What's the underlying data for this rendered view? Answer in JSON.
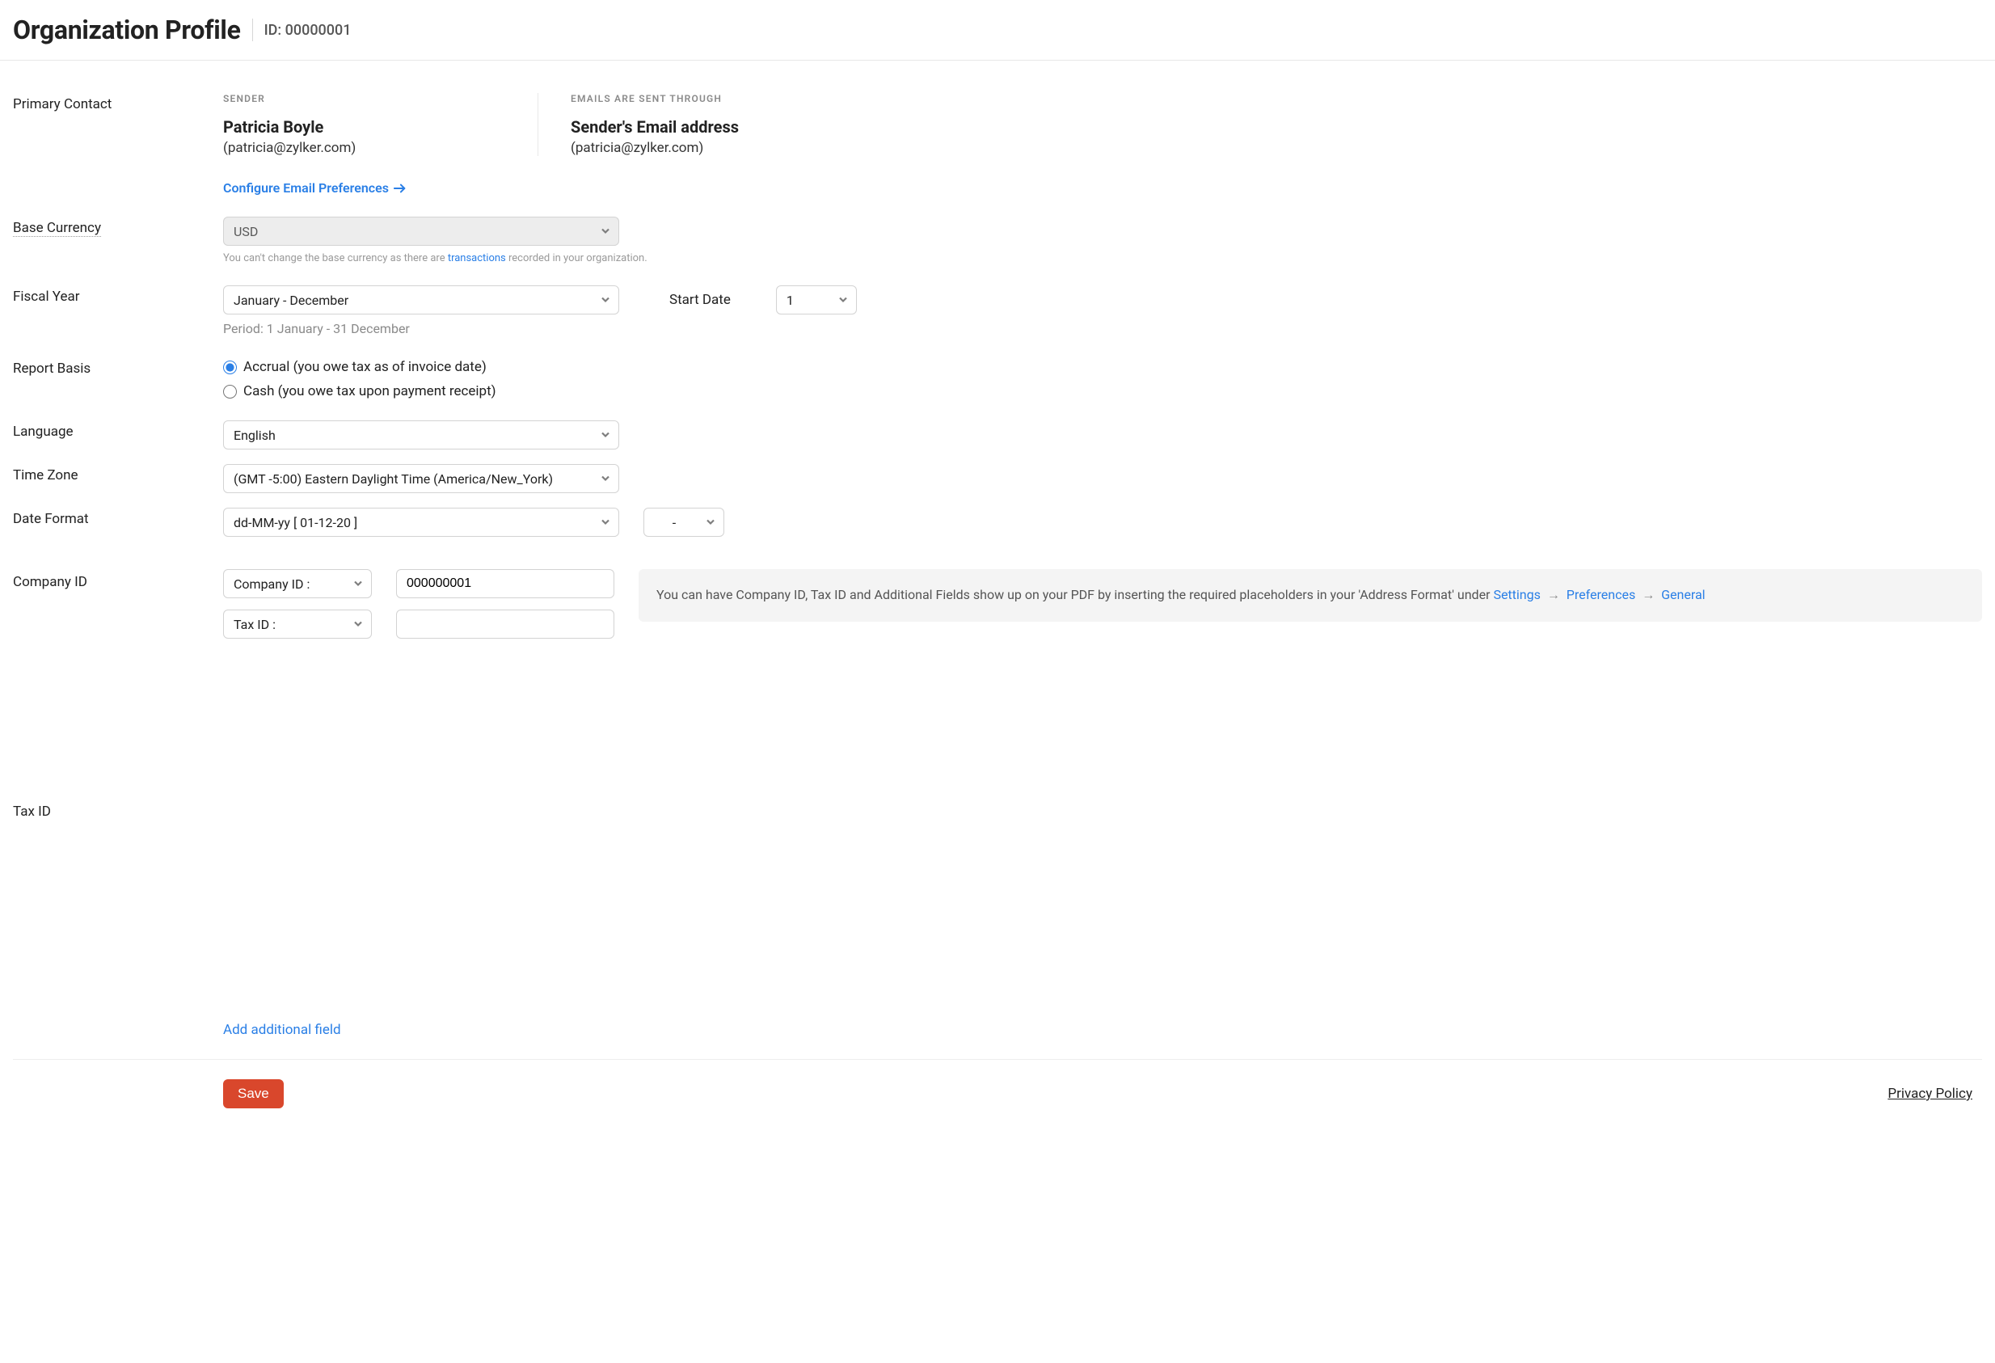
{
  "header": {
    "title": "Organization Profile",
    "id_label": "ID: 00000001"
  },
  "primary_contact": {
    "label": "Primary Contact",
    "sender_heading": "SENDER",
    "sender_name": "Patricia Boyle",
    "sender_email": "(patricia@zylker.com)",
    "sent_through_heading": "EMAILS ARE SENT THROUGH",
    "sent_through_name": "Sender's Email address",
    "sent_through_email": "(patricia@zylker.com)",
    "configure_link": "Configure Email Preferences"
  },
  "base_currency": {
    "label": "Base Currency",
    "value": "USD",
    "note_prefix": "You can't change the base currency as there are ",
    "note_link": "transactions",
    "note_suffix": " recorded in your organization."
  },
  "fiscal_year": {
    "label": "Fiscal Year",
    "value": "January - December",
    "start_date_label": "Start Date",
    "start_date_value": "1",
    "period": "Period: 1 January - 31 December"
  },
  "report_basis": {
    "label": "Report Basis",
    "accrual": "Accrual (you owe tax as of invoice date)",
    "cash": "Cash (you owe tax upon payment receipt)",
    "selected": "accrual"
  },
  "language": {
    "label": "Language",
    "value": "English"
  },
  "timezone": {
    "label": "Time Zone",
    "value": "(GMT -5:00) Eastern Daylight Time (America/New_York)"
  },
  "date_format": {
    "label": "Date Format",
    "value": "dd-MM-yy [ 01-12-20 ]",
    "separator_value": "-"
  },
  "company_id": {
    "label": "Company ID",
    "type_value": "Company ID :",
    "value": "000000001"
  },
  "tax_id": {
    "label": "Tax ID",
    "type_value": "Tax ID :",
    "value": ""
  },
  "info_box": {
    "text": "You can have Company ID, Tax ID and Additional Fields show up on your PDF by inserting the required placeholders in your 'Address Format' under ",
    "crumb1": "Settings",
    "crumb2": "Preferences",
    "crumb3": "General"
  },
  "add_field_link": "Add additional field",
  "footer": {
    "save": "Save",
    "privacy": "Privacy Policy"
  }
}
